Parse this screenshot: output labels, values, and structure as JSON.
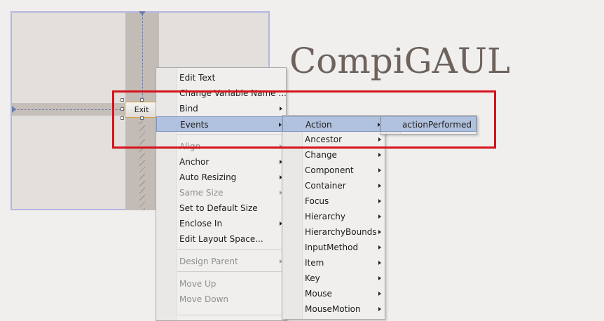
{
  "brand": {
    "title": "CompiGAUL"
  },
  "design": {
    "exit_button_label": "Exit"
  },
  "context_menu": {
    "items": [
      {
        "label": "Edit Text",
        "disabled": false,
        "submenu": false
      },
      {
        "label": "Change Variable Name ...",
        "disabled": false,
        "submenu": false
      },
      {
        "label": "Bind",
        "disabled": false,
        "submenu": true
      },
      {
        "label": "Events",
        "disabled": false,
        "submenu": true,
        "selected": true
      },
      {
        "label": "Align",
        "disabled": true,
        "submenu": true
      },
      {
        "label": "Anchor",
        "disabled": false,
        "submenu": true
      },
      {
        "label": "Auto Resizing",
        "disabled": false,
        "submenu": true
      },
      {
        "label": "Same Size",
        "disabled": true,
        "submenu": true
      },
      {
        "label": "Set to Default Size",
        "disabled": false,
        "submenu": false
      },
      {
        "label": "Enclose In",
        "disabled": false,
        "submenu": true
      },
      {
        "label": "Edit Layout Space...",
        "disabled": false,
        "submenu": false
      },
      {
        "label": "Design Parent",
        "disabled": true,
        "submenu": true
      },
      {
        "label": "Move Up",
        "disabled": true,
        "submenu": false
      },
      {
        "label": "Move Down",
        "disabled": true,
        "submenu": false
      }
    ]
  },
  "events_menu": {
    "items": [
      {
        "label": "Action",
        "selected": true
      },
      {
        "label": "Ancestor"
      },
      {
        "label": "Change"
      },
      {
        "label": "Component"
      },
      {
        "label": "Container"
      },
      {
        "label": "Focus"
      },
      {
        "label": "Hierarchy"
      },
      {
        "label": "HierarchyBounds"
      },
      {
        "label": "InputMethod"
      },
      {
        "label": "Item"
      },
      {
        "label": "Key"
      },
      {
        "label": "Mouse"
      },
      {
        "label": "MouseMotion"
      }
    ]
  },
  "action_menu": {
    "items": [
      {
        "label": "actionPerformed",
        "selected": true
      }
    ]
  },
  "colors": {
    "highlight": "#b1c2de",
    "callout": "#d4131b",
    "frame_border": "#b7b6e0",
    "brand_text": "#6d625c"
  }
}
